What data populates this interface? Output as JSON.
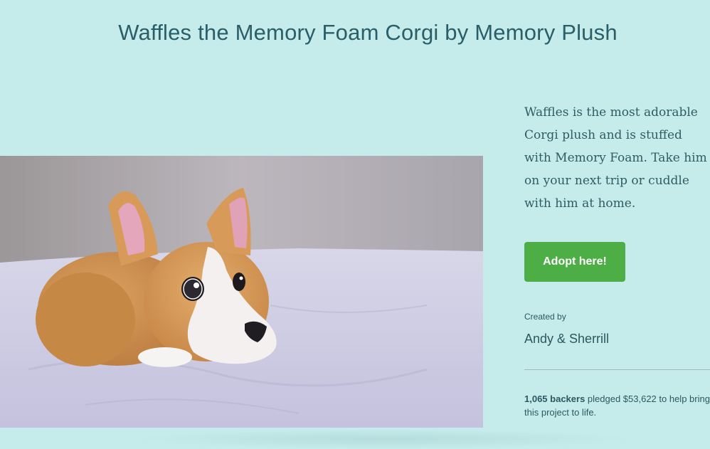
{
  "page": {
    "title": "Waffles the Memory Foam Corgi by Memory Plush"
  },
  "hero": {
    "image_icon": "corgi-plush-photo"
  },
  "sidebar": {
    "blurb": "Waffles is the most adorable Corgi plush and is stuffed with Memory Foam. Take him on your next trip or cuddle with him at home.",
    "adopt_button_label": "Adopt here!",
    "created_by_label": "Created by",
    "creator_name": "Andy & Sherrill",
    "funding": {
      "backers": "1,065 backers",
      "text": " pledged $53,622 to help bring this project to life."
    }
  },
  "colors": {
    "background": "#c5ebea",
    "title": "#2a5f69",
    "button": "#4cae44"
  }
}
